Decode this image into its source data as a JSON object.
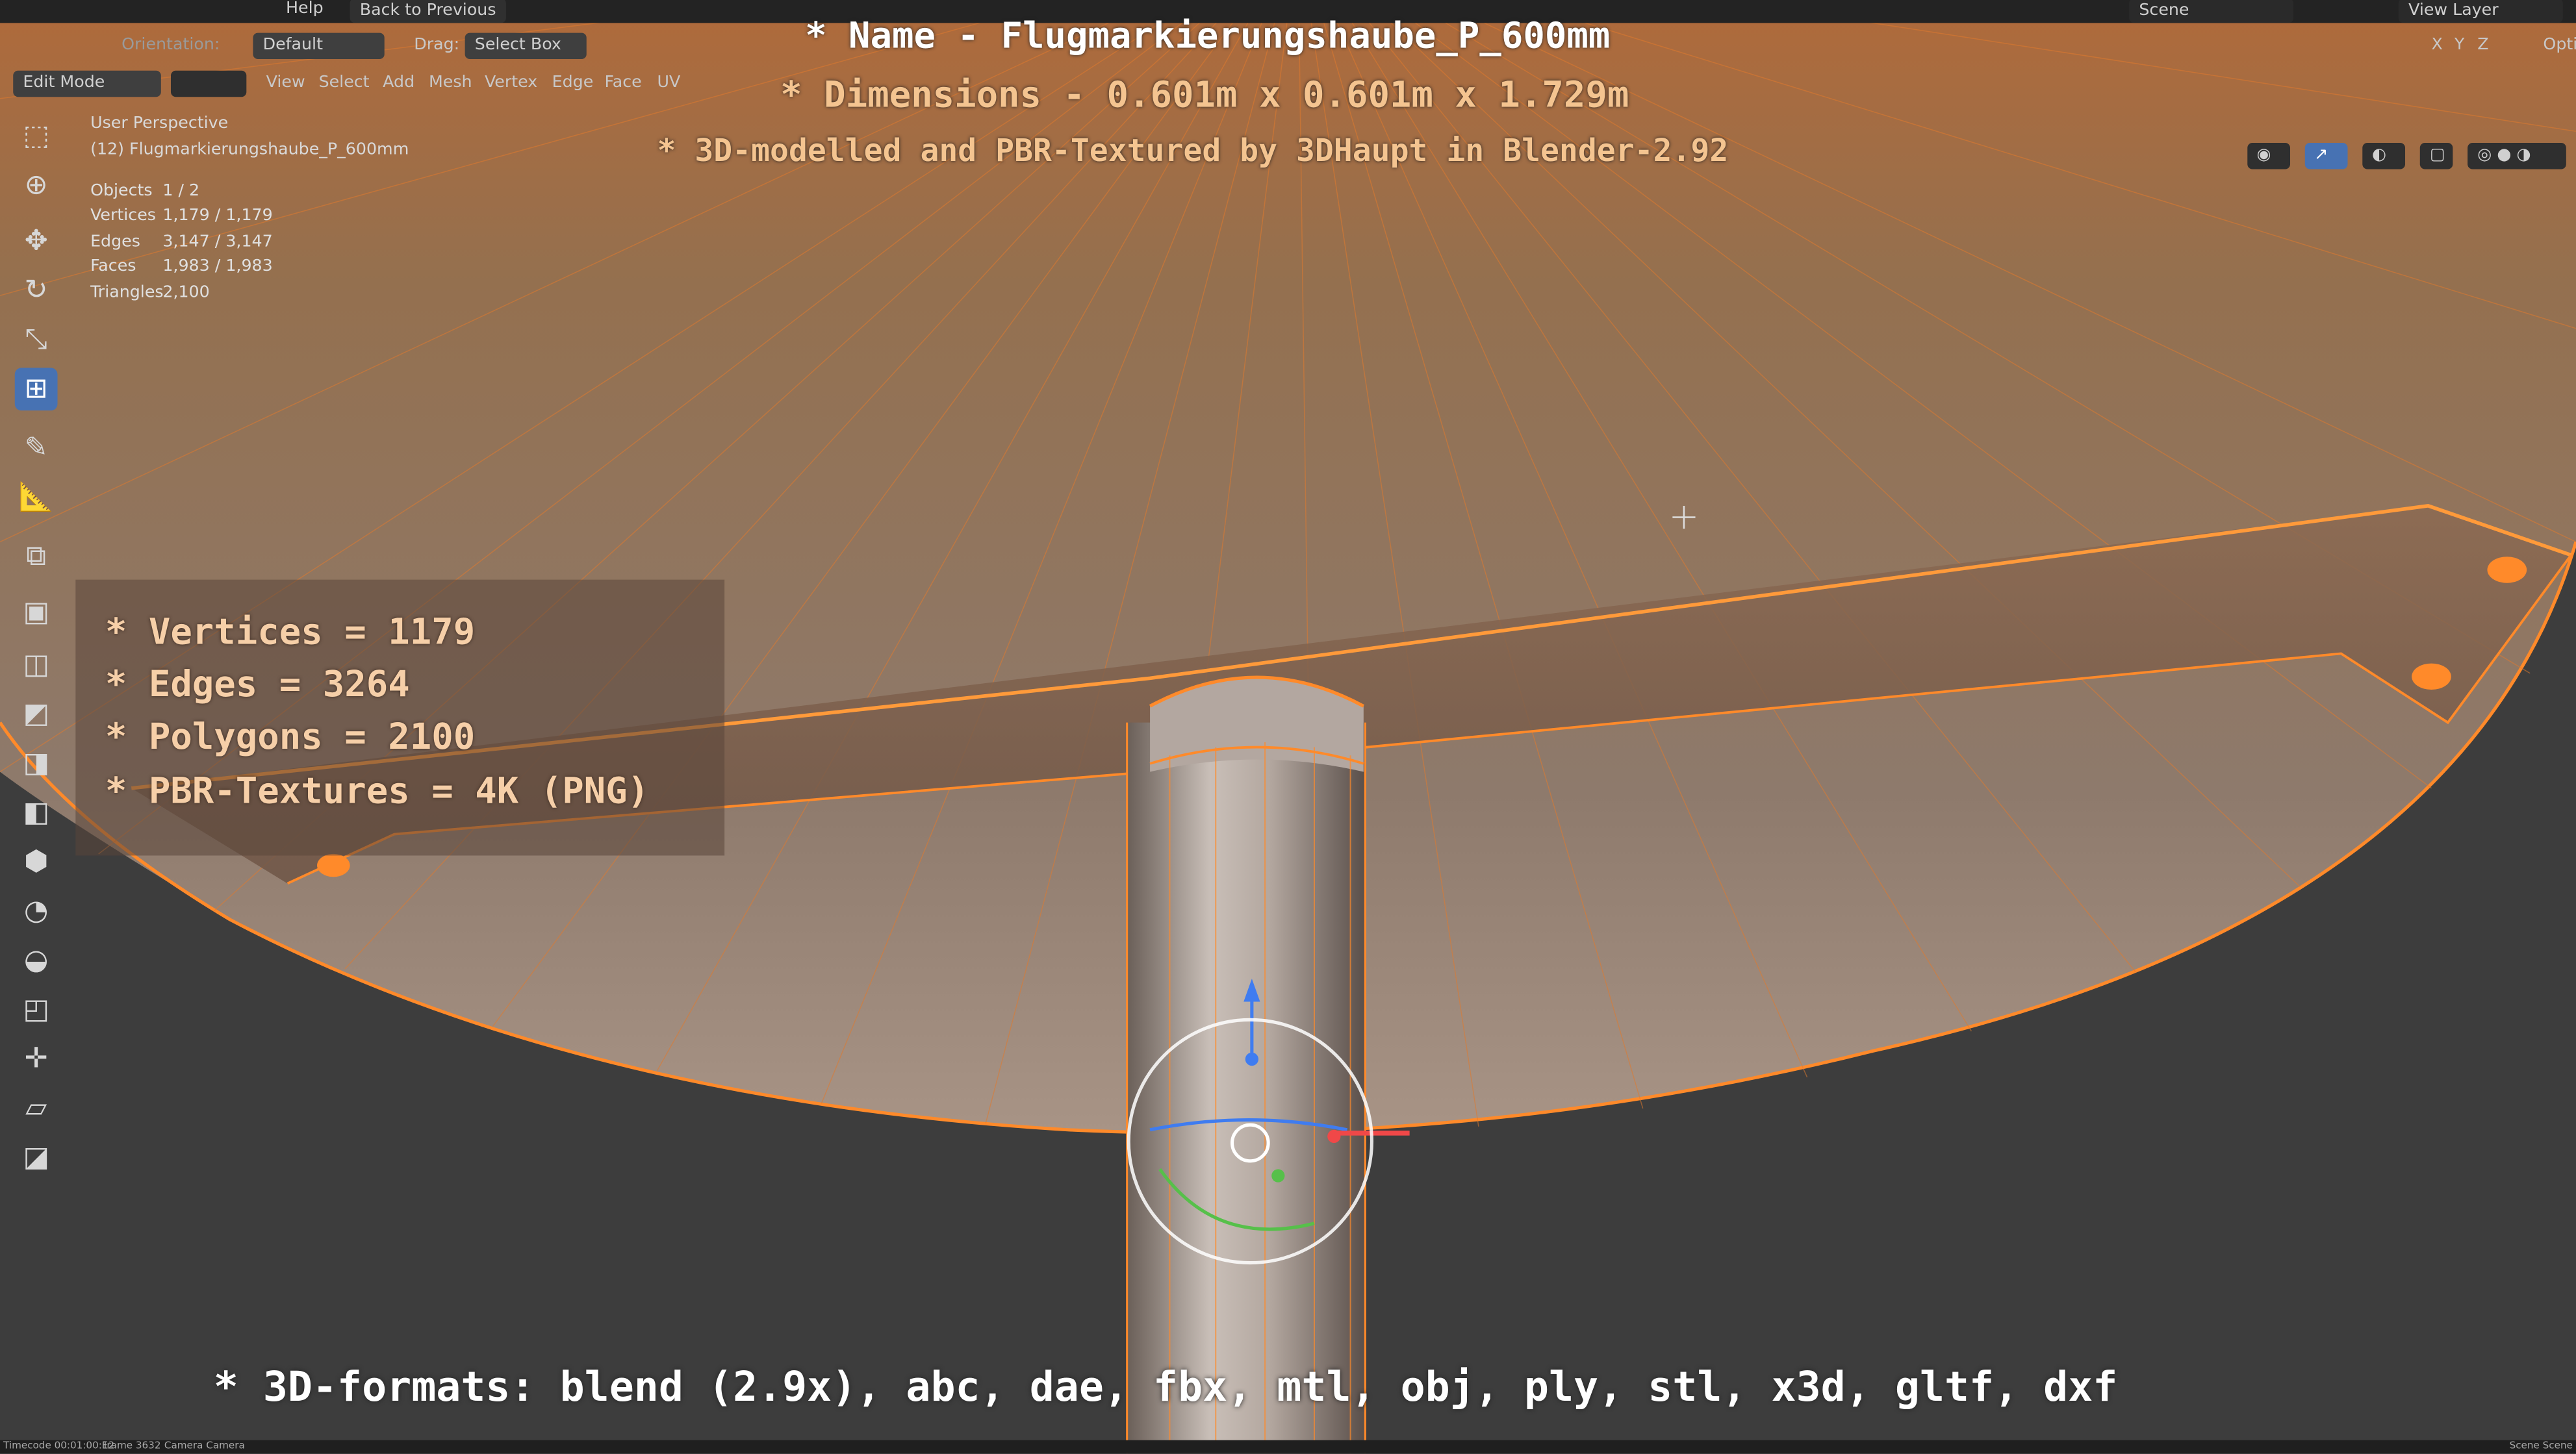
{
  "topbar": {
    "menu": [
      "Help"
    ],
    "back_button": "Back to Previous",
    "scene": "Scene",
    "view_layer": "View Layer"
  },
  "header": {
    "orientation_label": "Orientation:",
    "transform_pivot": "Default",
    "drag_label": "Drag:",
    "drag_value": "Select Box",
    "mode": "Edit Mode",
    "menus": [
      "View",
      "Select",
      "Add",
      "Mesh",
      "Vertex",
      "Edge",
      "Face",
      "UV"
    ],
    "axes": [
      "X",
      "Y",
      "Z"
    ],
    "options_label": "Opti"
  },
  "viewport_info": {
    "perspective": "User Perspective",
    "object": "(12) Flugmarkierungshaube_P_600mm",
    "stats": [
      {
        "label": "Objects",
        "value": "1 / 2"
      },
      {
        "label": "Vertices",
        "value": "1,179 / 1,179"
      },
      {
        "label": "Edges",
        "value": "3,147 / 3,147"
      },
      {
        "label": "Faces",
        "value": "1,983 / 1,983"
      },
      {
        "label": "Triangles",
        "value": "2,100"
      }
    ]
  },
  "overlay": {
    "name_line": "* Name - Flugmarkierungshaube_P_600mm",
    "dimensions_line": "* Dimensions -  0.601m x 0.601m x 1.729m",
    "credit_line": "* 3D-modelled and PBR-Textured by 3DHaupt in Blender-2.92",
    "stats_lines": [
      "* Vertices = 1179",
      "* Edges = 3264",
      "* Polygons = 2100",
      "* PBR-Textures = 4K (PNG)"
    ],
    "formats_line": "* 3D-formats: blend (2.9x), abc, dae, fbx, mtl, obj, ply, stl, x3d, gltf, dxf"
  },
  "statusbar": {
    "items": [
      "Timecode 00:01:00:12",
      "Frame 3632",
      "Camera Camera"
    ],
    "right": "Scene Scene"
  },
  "icons": {
    "tools": [
      "select-box-icon",
      "cursor-icon",
      "move-icon",
      "rotate-icon",
      "scale-icon",
      "transform-icon",
      "annotate-icon",
      "measure-icon",
      "add-cube-icon",
      "extrude-icon",
      "inset-icon",
      "bevel-icon",
      "loop-cut-icon",
      "knife-icon",
      "poly-build-icon",
      "spin-icon",
      "smooth-icon",
      "edge-slide-icon",
      "shrink-icon",
      "shear-icon",
      "rip-icon"
    ]
  },
  "colors": {
    "accent": "#4772b3",
    "wire": "#ff8a2a",
    "overlay_text": "#f4c490"
  }
}
